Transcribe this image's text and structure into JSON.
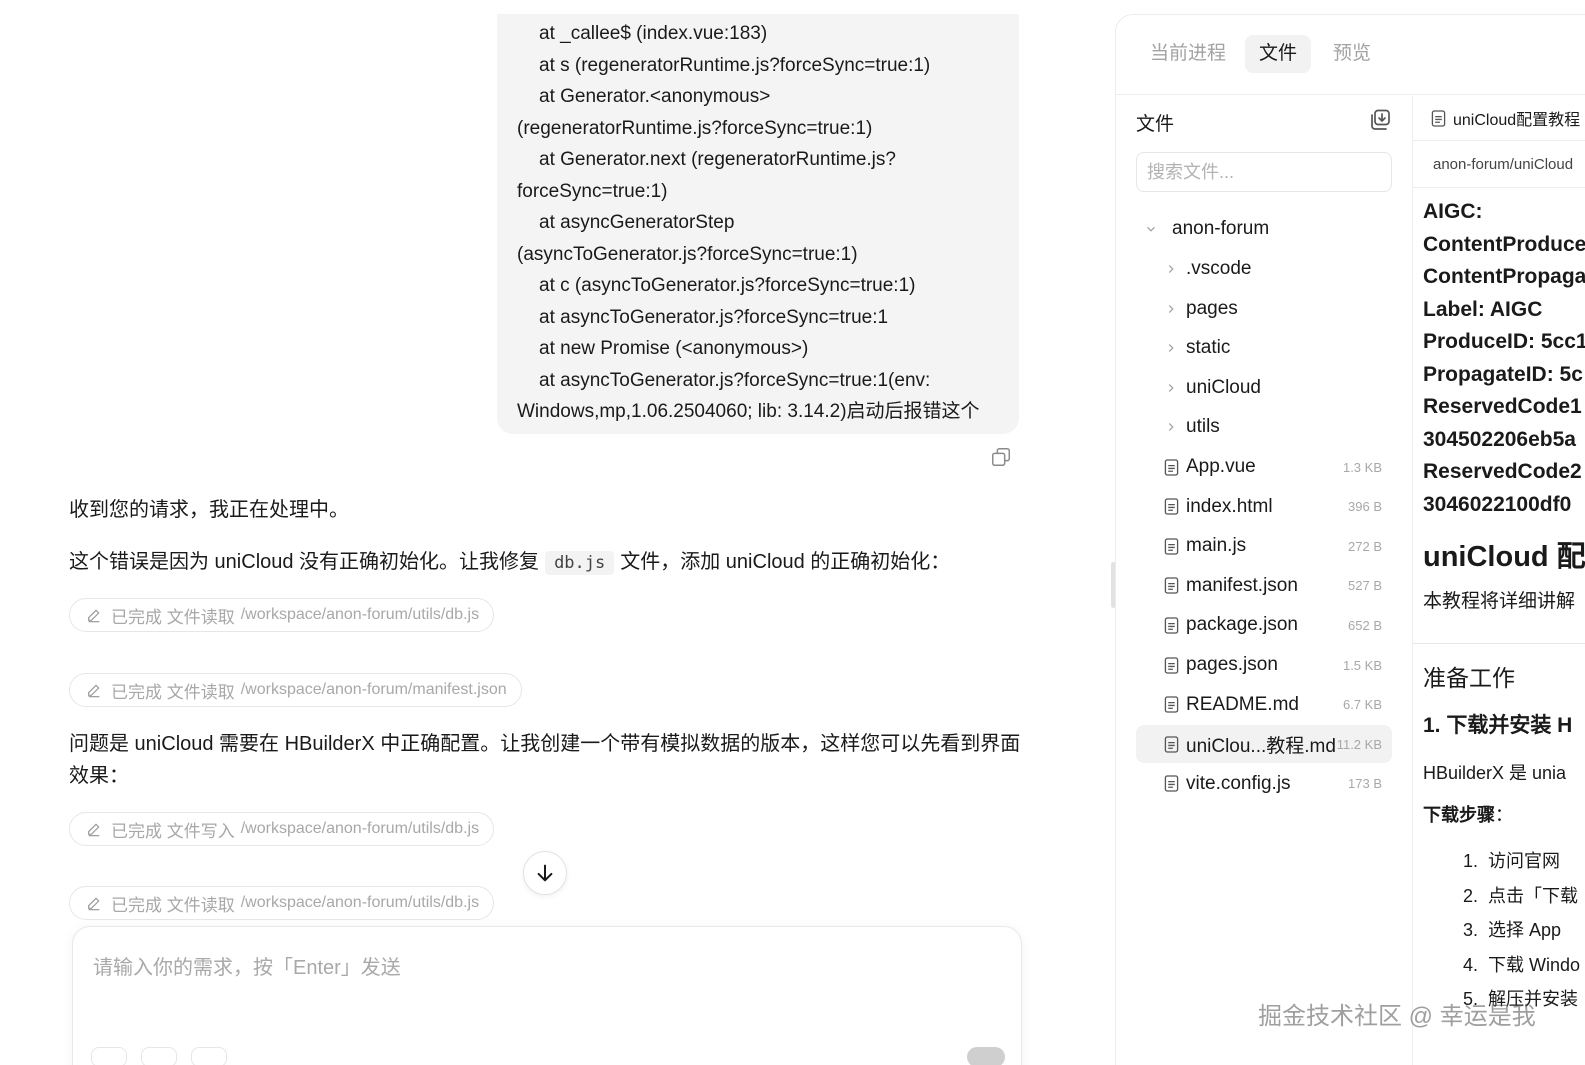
{
  "chat": {
    "user_bubble_lines": [
      {
        "text": "at _callee$ (index.vue:183)",
        "indent": true
      },
      {
        "text": "at s (regeneratorRuntime.js?forceSync=true:1)",
        "indent": true
      },
      {
        "text": "at Generator.<anonymous>",
        "indent": true
      },
      {
        "text": "(regeneratorRuntime.js?forceSync=true:1)",
        "indent": false
      },
      {
        "text": "at Generator.next (regeneratorRuntime.js?",
        "indent": true
      },
      {
        "text": "forceSync=true:1)",
        "indent": false
      },
      {
        "text": "at asyncGeneratorStep",
        "indent": true
      },
      {
        "text": "(asyncToGenerator.js?forceSync=true:1)",
        "indent": false
      },
      {
        "text": "at c (asyncToGenerator.js?forceSync=true:1)",
        "indent": true
      },
      {
        "text": "at asyncToGenerator.js?forceSync=true:1",
        "indent": true
      },
      {
        "text": "at new Promise (<anonymous>)",
        "indent": true
      },
      {
        "text": "at asyncToGenerator.js?forceSync=true:1(env:",
        "indent": true
      },
      {
        "text": "Windows,mp,1.06.2504060; lib: 3.14.2)启动后报错这个",
        "indent": false
      }
    ],
    "assistant": {
      "ack": "收到您的请求，我正在处理中。",
      "explain_before": "这个错误是因为 uniCloud 没有正确初始化。让我修复",
      "explain_code": "db.js",
      "explain_after": "文件，添加 uniCloud 的正确初始化：",
      "problem_line1": "问题是 uniCloud 需要在 HBuilderX 中正确配置。让我创建一个带有模拟数据的版本，这样您可以先看到界面",
      "problem_line2": "效果："
    },
    "tool_calls": [
      {
        "status": "已完成",
        "action": "文件读取",
        "path": "/workspace/anon-forum/utils/db.js"
      },
      {
        "status": "已完成",
        "action": "文件读取",
        "path": "/workspace/anon-forum/manifest.json"
      },
      {
        "status": "已完成",
        "action": "文件写入",
        "path": "/workspace/anon-forum/utils/db.js"
      },
      {
        "status": "已完成",
        "action": "文件读取",
        "path": "/workspace/anon-forum/utils/db.js"
      }
    ],
    "composer": {
      "placeholder": "请输入你的需求，按「Enter」发送"
    }
  },
  "panel": {
    "tabs": [
      {
        "label": "当前进程",
        "active": false
      },
      {
        "label": "文件",
        "active": true
      },
      {
        "label": "预览",
        "active": false
      }
    ],
    "files": {
      "title": "文件",
      "search_placeholder": "搜索文件...",
      "root": "anon-forum",
      "folders": [
        ".vscode",
        "pages",
        "static",
        "uniCloud",
        "utils"
      ],
      "items": [
        {
          "name": "App.vue",
          "size": "1.3 KB",
          "selected": false
        },
        {
          "name": "index.html",
          "size": "396 B",
          "selected": false
        },
        {
          "name": "main.js",
          "size": "272 B",
          "selected": false
        },
        {
          "name": "manifest.json",
          "size": "527 B",
          "selected": false
        },
        {
          "name": "package.json",
          "size": "652 B",
          "selected": false
        },
        {
          "name": "pages.json",
          "size": "1.5 KB",
          "selected": false
        },
        {
          "name": "README.md",
          "size": "6.7 KB",
          "selected": false
        },
        {
          "name": "uniClou...教程.md",
          "size": "11.2 KB",
          "selected": true
        },
        {
          "name": "vite.config.js",
          "size": "173 B",
          "selected": false
        }
      ]
    },
    "preview": {
      "tab_title": "uniCloud配置教程",
      "path": "anon-forum/uniCloud",
      "meta_lines": [
        "AIGC:",
        "ContentProducer",
        "ContentPropagator",
        "Label: AIGC",
        "ProduceID: 5cc1",
        "PropagateID: 5c",
        "ReservedCode1",
        "304502206eb5a",
        "ReservedCode2",
        "3046022100df0"
      ],
      "heading1": "uniCloud 配",
      "intro": "本教程将详细讲解",
      "heading2": "准备工作",
      "heading3": "1. 下载并安装 H",
      "para": "HBuilderX 是 unia",
      "steps_label": "下载步骤",
      "steps_colon": "：",
      "steps": [
        "访问官网",
        "点击「下载",
        "选择 App",
        "下载 Windo",
        "解压并安装"
      ]
    }
  },
  "watermark": "掘金技术社区 @ 幸运是我"
}
